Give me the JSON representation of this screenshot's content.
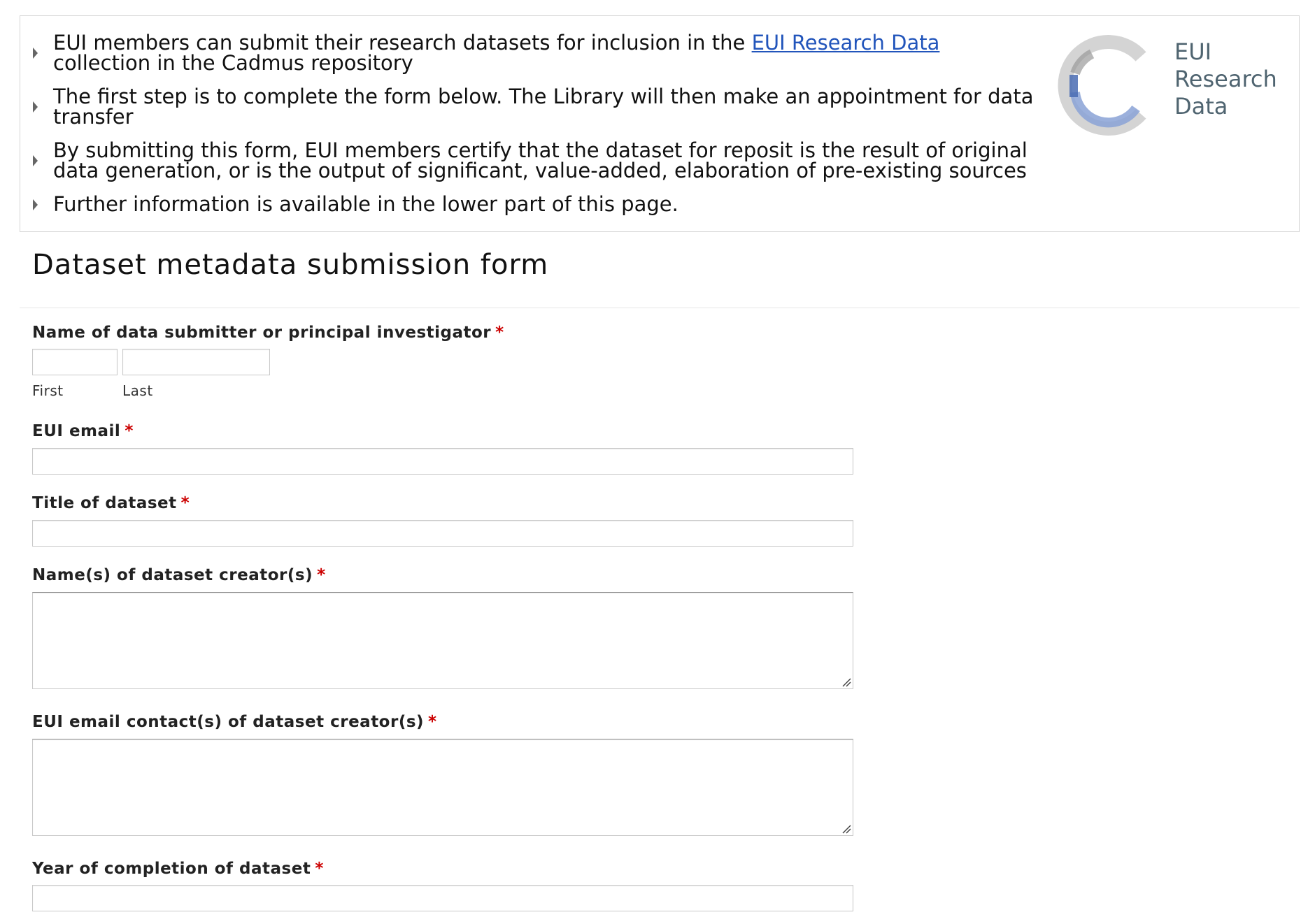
{
  "info": {
    "items": [
      {
        "before": "EUI members can submit their research datasets for inclusion in the ",
        "link": "EUI Research Data",
        "after": " collection in the Cadmus repository"
      },
      {
        "text": "The first step is to complete the form below. The Library will then make an appointment for data transfer"
      },
      {
        "text": "By submitting this form, EUI members certify that the dataset for reposit is the result of original data generation, or is the output of significant, value-added, elaboration of pre-existing sources"
      },
      {
        "text": "Further information is available in the lower part of this page."
      }
    ],
    "logo": {
      "line1": "EUI",
      "line2": "Research",
      "line3": "Data"
    }
  },
  "form": {
    "title": "Dataset metadata submission form",
    "required_marker": "*",
    "fields": {
      "name": {
        "label": "Name of data submitter or principal investigator",
        "first_label": "First",
        "last_label": "Last"
      },
      "email": {
        "label": "EUI email"
      },
      "dataset_title": {
        "label": "Title of dataset"
      },
      "creators": {
        "label": "Name(s) of dataset creator(s)"
      },
      "creator_emails": {
        "label": "EUI email contact(s) of dataset creator(s)"
      },
      "year": {
        "label": "Year of completion of dataset"
      }
    }
  },
  "colors": {
    "link": "#2255bb",
    "required": "#cc0000",
    "logo_text": "#4f6470"
  }
}
